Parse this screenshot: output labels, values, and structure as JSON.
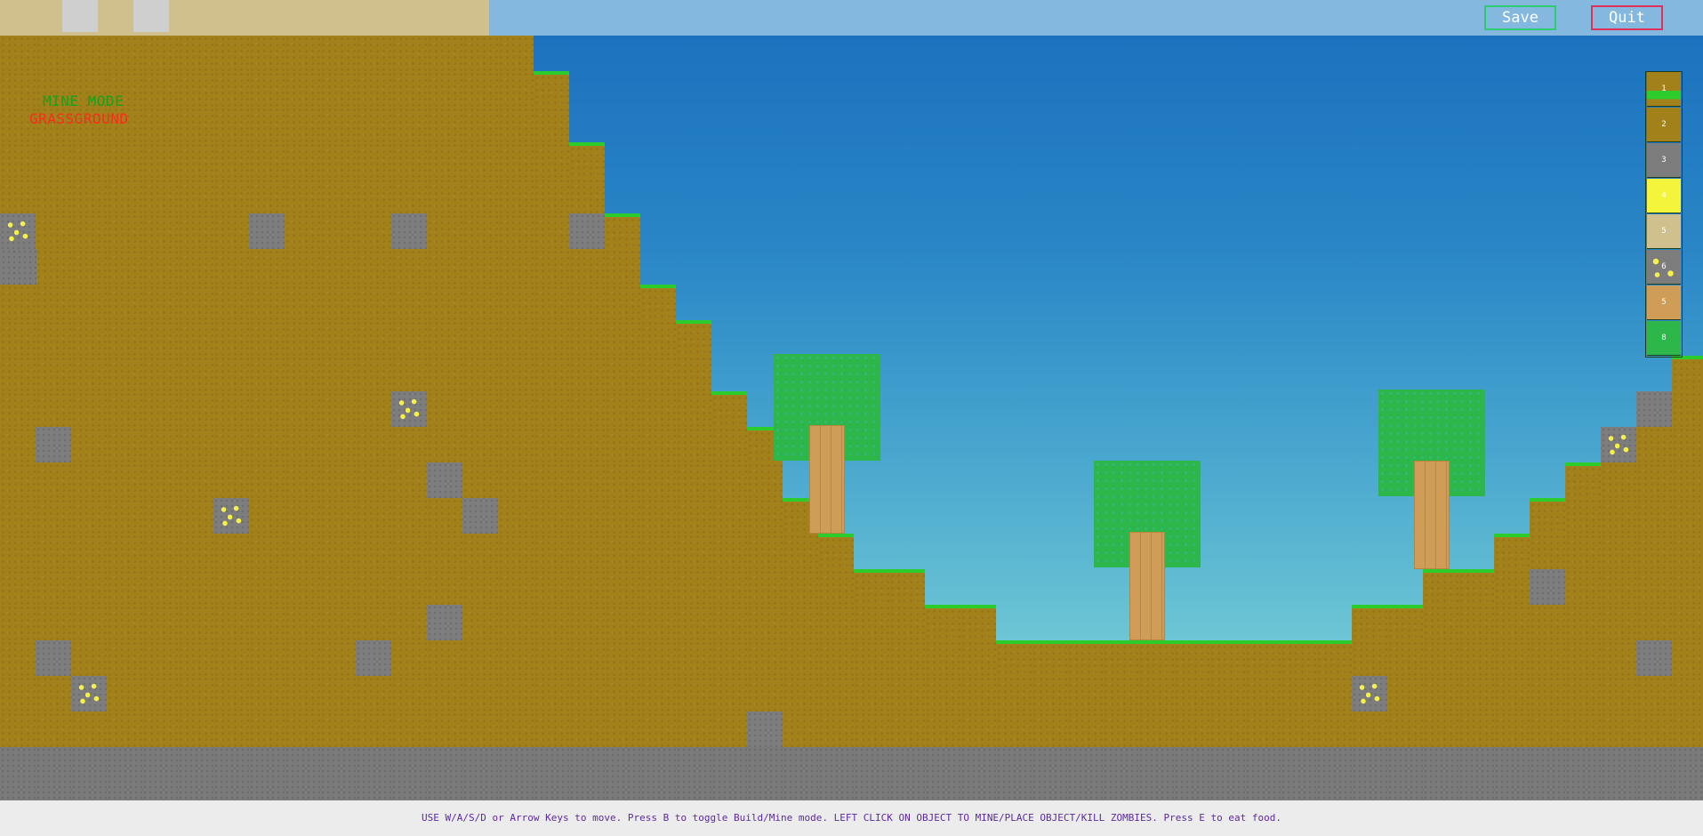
{
  "topbar": {
    "save_label": "Save",
    "quit_label": "Quit"
  },
  "hud": {
    "mode": "MINE MODE",
    "selected_block": "GRASSGROUND"
  },
  "hotbar": [
    {
      "label": "1",
      "block": "grass"
    },
    {
      "label": "2",
      "block": "dirt"
    },
    {
      "label": "3",
      "block": "stone"
    },
    {
      "label": "4",
      "block": "light"
    },
    {
      "label": "5",
      "block": "sand"
    },
    {
      "label": "6",
      "block": "gold-ore"
    },
    {
      "label": "5",
      "block": "wood"
    },
    {
      "label": "8",
      "block": "leaves"
    }
  ],
  "instructions": "USE W/A/S/D or Arrow Keys to move. Press B to toggle Build/Mine mode. LEFT CLICK ON OBJECT TO MINE/PLACE OBJECT/KILL ZOMBIES. Press E to eat food.",
  "colors": {
    "sky_top": "#1a6fbd",
    "sky_bottom": "#8fd3d6",
    "dirt": "#a2811a",
    "grass": "#2ccc2c",
    "stone": "#7d7d7d",
    "gold": "#f6f04a",
    "leaves": "#2db64a",
    "wood": "#cf9d57"
  }
}
